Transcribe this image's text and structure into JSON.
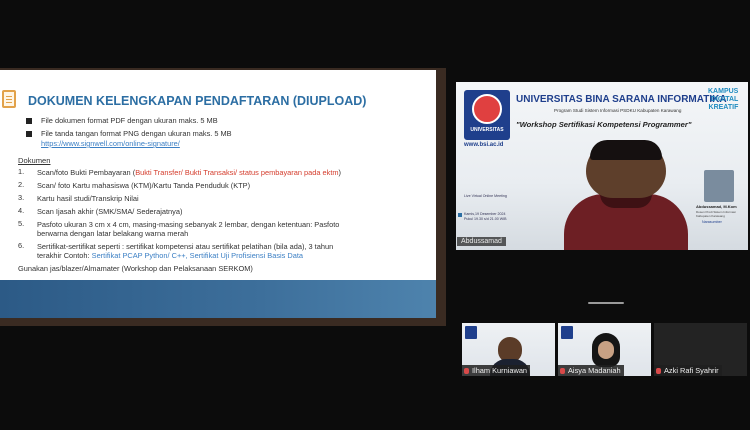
{
  "slide": {
    "title": "DOKUMEN KELENGKAPAN PENDAFTARAN (DIUPLOAD)",
    "file_items": [
      "File dokumen format PDF dengan ukuran maks. 5 MB",
      "File tanda tangan format PNG dengan ukuran maks. 5 MB"
    ],
    "link": "https://www.signwell.com/online-signature/",
    "dokumen_label": "Dokumen",
    "items": [
      {
        "num": "1.",
        "text": "Scan/foto Bukti Pembayaran (",
        "red": "Bukti Transfer/ Bukti Transaksi/ status pembayaran pada ektm",
        "tail": ")"
      },
      {
        "num": "2.",
        "text": "Scan/ foto Kartu mahasiswa (KTM)/Kartu Tanda Penduduk (KTP)"
      },
      {
        "num": "3.",
        "text": "Kartu hasil studi/Transkrip Nilai"
      },
      {
        "num": "4.",
        "text": "Scan Ijasah akhir (SMK/SMA/ Sederajatnya)"
      },
      {
        "num": "5.",
        "line1": "Pasfoto ukuran 3 cm x 4 cm, masing-masing sebanyak 2 lembar, dengan ketentuan: Pasfoto",
        "line2": "berwarna dengan latar belakang warna merah"
      },
      {
        "num": "6.",
        "line1": "Sertifikat-sertifikat  seperti  : sertifikat kompetensi atau sertifikat pelatihan (bila ada), 3 tahun",
        "line2_prefix": "terakhir Contoh: ",
        "line2_blue": "Sertifikat PCAP Python/ C++, Sertifikat Uji Profisiensi Basis Data"
      }
    ],
    "footer_note": "Gunakan jas/blazer/Almamater (Workshop dan Pelaksanaan SERKOM)"
  },
  "main_video": {
    "banner": {
      "university": "UNIVERSITAS BINA SARANA INFORMATIKA",
      "program": "Program Studi Sistem Informasi PSDKU Kabupaten Karawang",
      "workshop": "\"Workshop Sertifikasi Kompetensi Programmer\"",
      "site": "www.bsi.ac.id",
      "logo_text": "UNIVERSITAS",
      "kampus": [
        "KAMPUS",
        "DIGITAL",
        "KREATIF"
      ],
      "zoom": "Live Virtual Online Meeting",
      "date": "Kamis,19 Desember 2024",
      "time": "Pukul 19.30 s/d 21.00 WIB",
      "speaker_name": "Abdussamad, M.Kom",
      "speaker_role": "Dosen Prodi Sistem Informasi",
      "speaker_role2": "Kabupaten Karawang",
      "narasumber": "Narasumber"
    },
    "participant_name": "Abdussamad"
  },
  "thumbnails": [
    {
      "name": "Ilham Kurniawan",
      "mic": "muted"
    },
    {
      "name": "Aisya Madaniah",
      "mic": "muted"
    },
    {
      "name": "Azki Rafi Syahrir",
      "mic": "muted"
    }
  ],
  "colors": {
    "title_blue": "#2c6ea3",
    "link_blue": "#3b7fc4",
    "red_text": "#d43c2c",
    "footer_blue": "#3d6f9b",
    "muted_mic": "#d94a4a"
  }
}
